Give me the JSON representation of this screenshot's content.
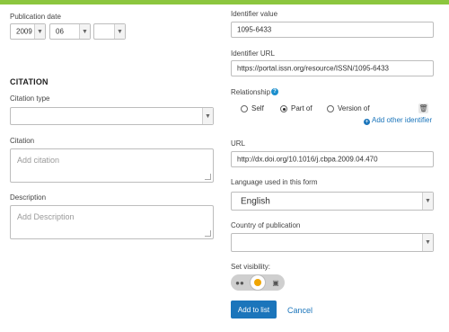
{
  "left": {
    "publication_date": {
      "label": "Publication date",
      "year": "2009",
      "month": "06",
      "day": ""
    },
    "citation_heading": "CITATION",
    "citation_type": {
      "label": "Citation type",
      "value": ""
    },
    "citation": {
      "label": "Citation",
      "placeholder": "Add citation"
    },
    "description": {
      "label": "Description",
      "placeholder": "Add Description"
    }
  },
  "right": {
    "identifier_value": {
      "label": "Identifier value",
      "value": "1095-6433"
    },
    "identifier_url": {
      "label": "Identifier URL",
      "value": "https://portal.issn.org/resource/ISSN/1095-6433"
    },
    "relationship": {
      "label": "Relationship",
      "help_glyph": "?",
      "options": [
        "Self",
        "Part of",
        "Version of"
      ],
      "selected": "Part of",
      "add_other": "Add other identifier"
    },
    "url": {
      "label": "URL",
      "value": "http://dx.doi.org/10.1016/j.cbpa.2009.04.470"
    },
    "language": {
      "label": "Language used in this form",
      "value": "English"
    },
    "country": {
      "label": "Country of publication",
      "value": ""
    },
    "visibility": {
      "label": "Set visibility:",
      "selected": "trusted-parties"
    },
    "actions": {
      "add_label": "Add to list",
      "cancel_label": "Cancel"
    }
  },
  "colors": {
    "accent": "#8cc63f",
    "primary": "#1b75bb",
    "help": "#1b8fcd"
  },
  "icons": [
    "caret-down-icon",
    "help-icon",
    "plus-icon",
    "trash-icon",
    "everyone-icon",
    "trusted-icon",
    "lock-icon"
  ]
}
